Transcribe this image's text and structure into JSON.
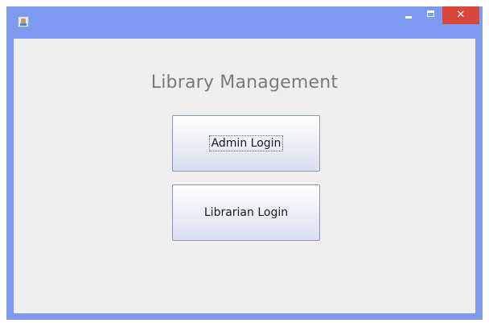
{
  "window": {
    "icon": "java-cup-icon",
    "controls": {
      "minimize_icon": "minimize-icon",
      "maximize_icon": "maximize-icon",
      "close_label": "✕"
    },
    "colors": {
      "titlebar": "#7e9af0",
      "close": "#d9463a",
      "content_bg": "#efefef"
    }
  },
  "main": {
    "title": "Library Management",
    "buttons": {
      "admin_label": "Admin Login",
      "librarian_label": "Librarian Login"
    }
  }
}
